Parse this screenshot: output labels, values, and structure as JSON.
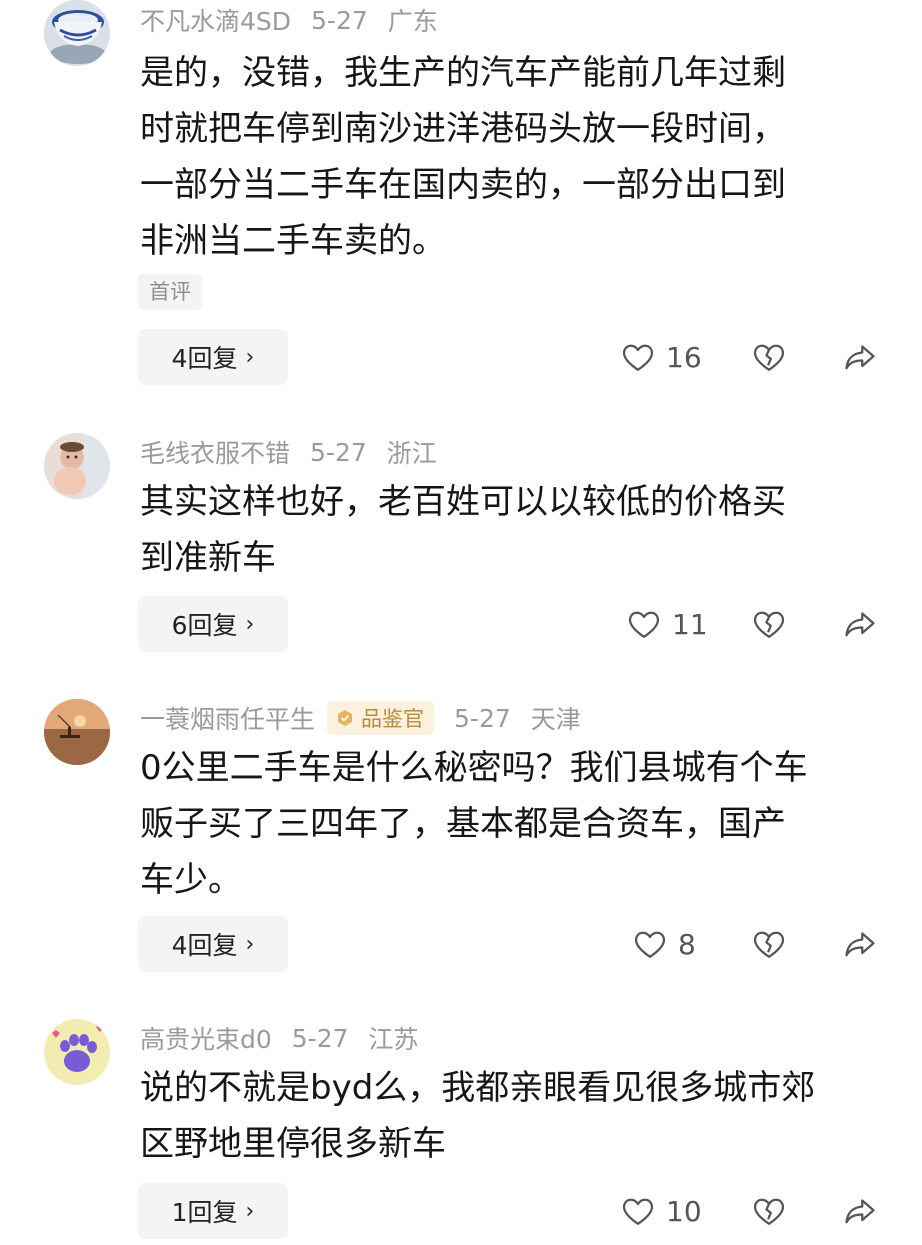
{
  "comments": [
    {
      "username": "不凡水滴4SD",
      "date": "5-27",
      "location": "广东",
      "text": "是的，没错，我生产的汽车产能前几年过剩\n时就把车停到南沙进洋港码头放一段时间，\n一部分当二手车在国内卖的，一部分出口到\n非洲当二手车卖的。",
      "tag": "首评",
      "replies": "4回复",
      "likes": "16"
    },
    {
      "username": "毛线衣服不错",
      "date": "5-27",
      "location": "浙江",
      "text": "其实这样也好，老百姓可以以较低的价格买\n到准新车",
      "replies": "6回复",
      "likes": "11"
    },
    {
      "username": "一蓑烟雨任平生",
      "badge": "品鉴官",
      "date": "5-27",
      "location": "天津",
      "text": "0公里二手车是什么秘密吗？我们县城有个车\n贩子买了三四年了，基本都是合资车，国产\n车少。",
      "replies": "4回复",
      "likes": "8"
    },
    {
      "username": "高贵光束d0",
      "date": "5-27",
      "location": "江苏",
      "text": "说的不就是byd么，我都亲眼看见很多城市郊\n区野地里停很多新车",
      "replies": "1回复",
      "likes": "10"
    }
  ],
  "colors": {
    "meta_text": "#9a9a9a",
    "body_text": "#161616",
    "button_bg": "#f4f4f4",
    "badge_bg": "#fbf1de",
    "badge_text": "#b98a3c"
  },
  "icons": {
    "like": "heart-outline-icon",
    "dislike": "broken-heart-icon",
    "share": "share-arrow-icon",
    "more_replies": "chevron-right-icon",
    "badge": "medal-icon"
  }
}
